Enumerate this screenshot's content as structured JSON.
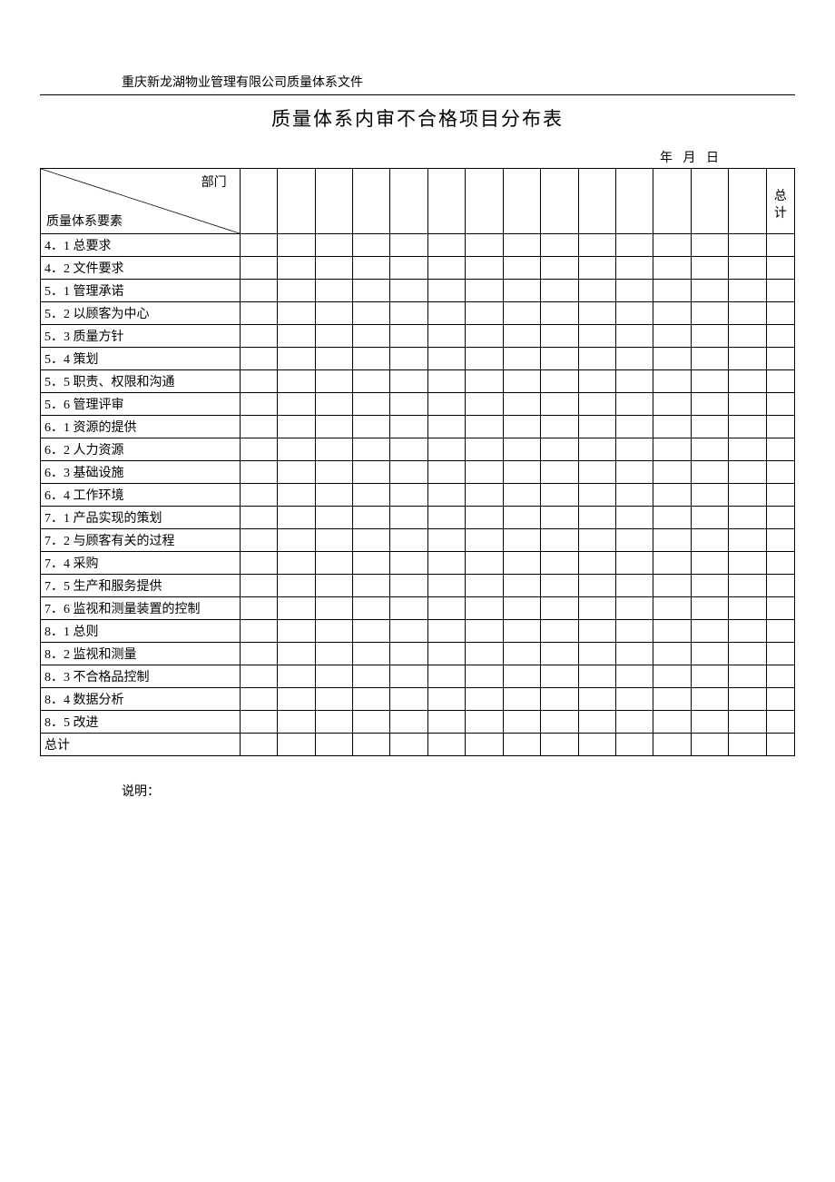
{
  "header_text": "重庆新龙湖物业管理有限公司质量体系文件",
  "title": "质量体系内审不合格项目分布表",
  "date_labels": {
    "year": "年",
    "month": "月",
    "day": "日"
  },
  "diag": {
    "top": "部门",
    "bottom": "质量体系要素"
  },
  "total_header": "总计",
  "rows": [
    "4．1 总要求",
    "4．2 文件要求",
    "5．1 管理承诺",
    "5．2 以顾客为中心",
    "5．3 质量方针",
    "5．4 策划",
    "5．5 职责、权限和沟通",
    "5．6 管理评审",
    "6．1 资源的提供",
    "6．2 人力资源",
    "6．3 基础设施",
    "6．4 工作环境",
    "7．1 产品实现的策划",
    "7．2 与顾客有关的过程",
    "7．4 采购",
    "7．5 生产和服务提供",
    "7．6 监视和测量装置的控制",
    "8．1 总则",
    "8．2 监视和测量",
    "8．3 不合格品控制",
    "8．4 数据分析",
    "8．5 改进",
    "总计"
  ],
  "data_column_count": 14,
  "note_label": "说明："
}
